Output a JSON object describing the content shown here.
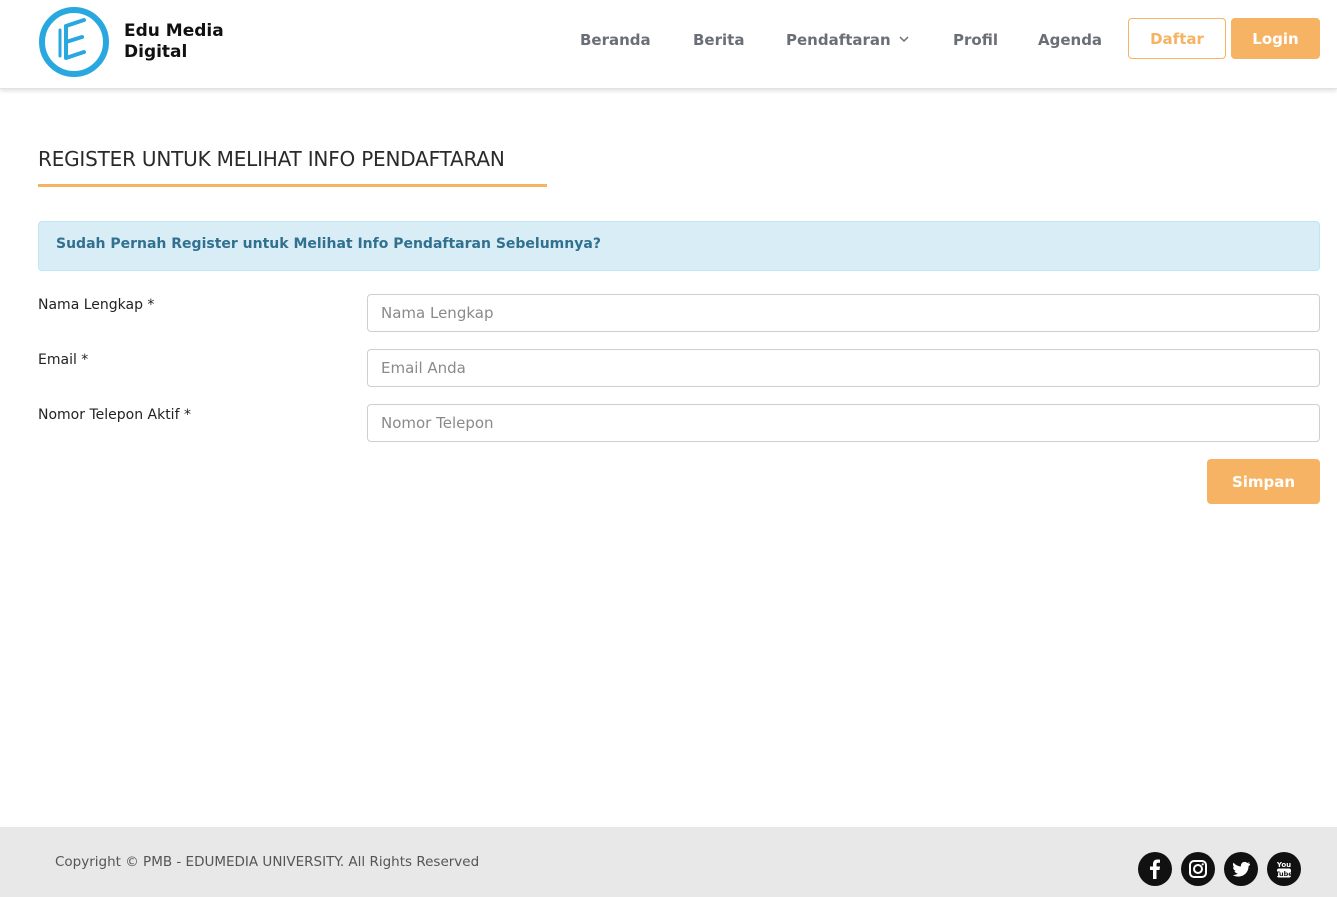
{
  "header": {
    "brand_line1": "Edu Media",
    "brand_line2": "Digital",
    "nav": [
      {
        "label": "Beranda"
      },
      {
        "label": "Berita"
      },
      {
        "label": "Pendaftaran"
      },
      {
        "label": "Profil"
      },
      {
        "label": "Agenda"
      }
    ],
    "daftar_label": "Daftar",
    "login_label": "Login"
  },
  "main": {
    "title": "REGISTER UNTUK MELIHAT INFO PENDAFTARAN",
    "alert_text": "Sudah Pernah Register untuk Melihat Info Pendaftaran Sebelumnya?",
    "form": {
      "fields": [
        {
          "label": "Nama Lengkap *",
          "placeholder": "Nama Lengkap",
          "value": ""
        },
        {
          "label": "Email *",
          "placeholder": "Email Anda",
          "value": ""
        },
        {
          "label": "Nomor Telepon Aktif *",
          "placeholder": "Nomor Telepon",
          "value": ""
        }
      ],
      "submit_label": "Simpan"
    }
  },
  "footer": {
    "copyright": "Copyright © PMB - EDUMEDIA UNIVERSITY. All Rights Reserved",
    "social": [
      "facebook-icon",
      "instagram-icon",
      "twitter-icon",
      "youtube-icon"
    ]
  },
  "colors": {
    "accent": "#f5b363",
    "logo_blue": "#29a8e0",
    "alert_bg": "#d9edf7",
    "alert_text": "#31708f",
    "footer_bg": "#e8e8e8"
  }
}
